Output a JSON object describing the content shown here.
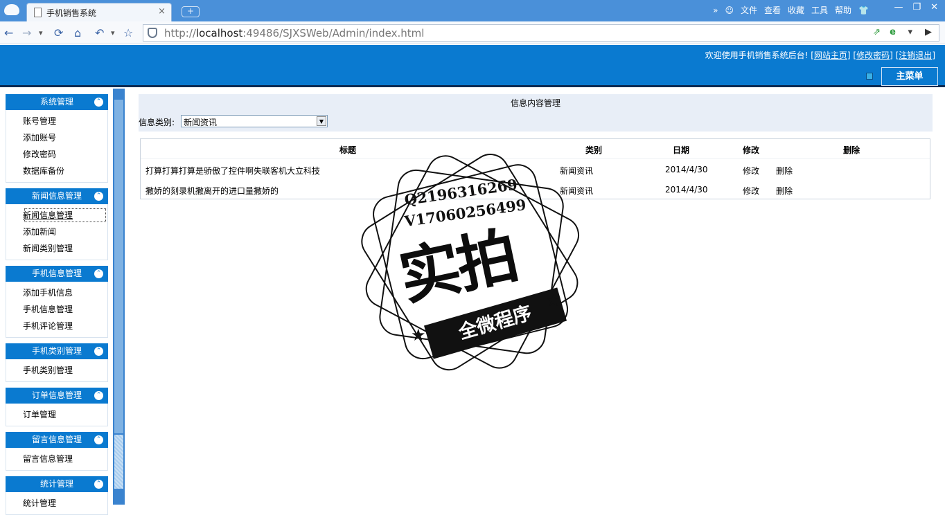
{
  "browser": {
    "tab_title": "手机销售系统",
    "tab_close": "×",
    "new_tab": "+",
    "menu": {
      "more": "»",
      "file": "文件",
      "view": "查看",
      "favorites": "收藏",
      "tools": "工具",
      "help": "帮助"
    },
    "window_controls": {
      "minimize": "—",
      "restore": "❐",
      "close": "✕"
    },
    "nav": {
      "back": "←",
      "forward": "→",
      "dropdown": "▾",
      "refresh": "⟳",
      "home": "⌂",
      "undo": "↶",
      "favorite": "☆"
    },
    "url_host_prefix": "http://",
    "url_host": "localhost",
    "url_rest": ":49486/SJXSWeb/Admin/index.html"
  },
  "app": {
    "welcome": "欢迎使用手机销售系统后台!",
    "links": {
      "home": "网站主页",
      "change_password": "修改密码",
      "logout": "注销退出"
    },
    "main_menu": "主菜单"
  },
  "sidebar": {
    "groups": [
      {
        "title": "系统管理",
        "items": [
          "账号管理",
          "添加账号",
          "修改密码",
          "数据库备份"
        ]
      },
      {
        "title": "新闻信息管理",
        "items": [
          "新闻信息管理",
          "添加新闻",
          "新闻类别管理"
        ]
      },
      {
        "title": "手机信息管理",
        "items": [
          "添加手机信息",
          "手机信息管理",
          "手机评论管理"
        ]
      },
      {
        "title": "手机类别管理",
        "items": [
          "手机类别管理"
        ]
      },
      {
        "title": "订单信息管理",
        "items": [
          "订单管理"
        ]
      },
      {
        "title": "留言信息管理",
        "items": [
          "留言信息管理"
        ]
      },
      {
        "title": "统计管理",
        "items": [
          "统计管理"
        ]
      }
    ]
  },
  "main": {
    "title": "信息内容管理",
    "filter_label": "信息类别:",
    "filter_value": "新闻资讯",
    "table": {
      "headers": [
        "标题",
        "类别",
        "日期",
        "修改",
        "删除"
      ],
      "rows": [
        {
          "title": "打算打算打算是骄傲了控件啊失联客机大立科技",
          "category": "新闻资讯",
          "date": "2014/4/30",
          "edit": "修改",
          "delete": "删除"
        },
        {
          "title": "撒娇的刻录机撒离开的进口量撒娇的",
          "category": "新闻资讯",
          "date": "2014/4/30",
          "edit": "修改",
          "delete": "删除"
        }
      ]
    }
  },
  "watermark": {
    "line1": "Q2196316269",
    "line2": "V17060256499",
    "big": "实拍",
    "ribbon": "全微程序"
  }
}
